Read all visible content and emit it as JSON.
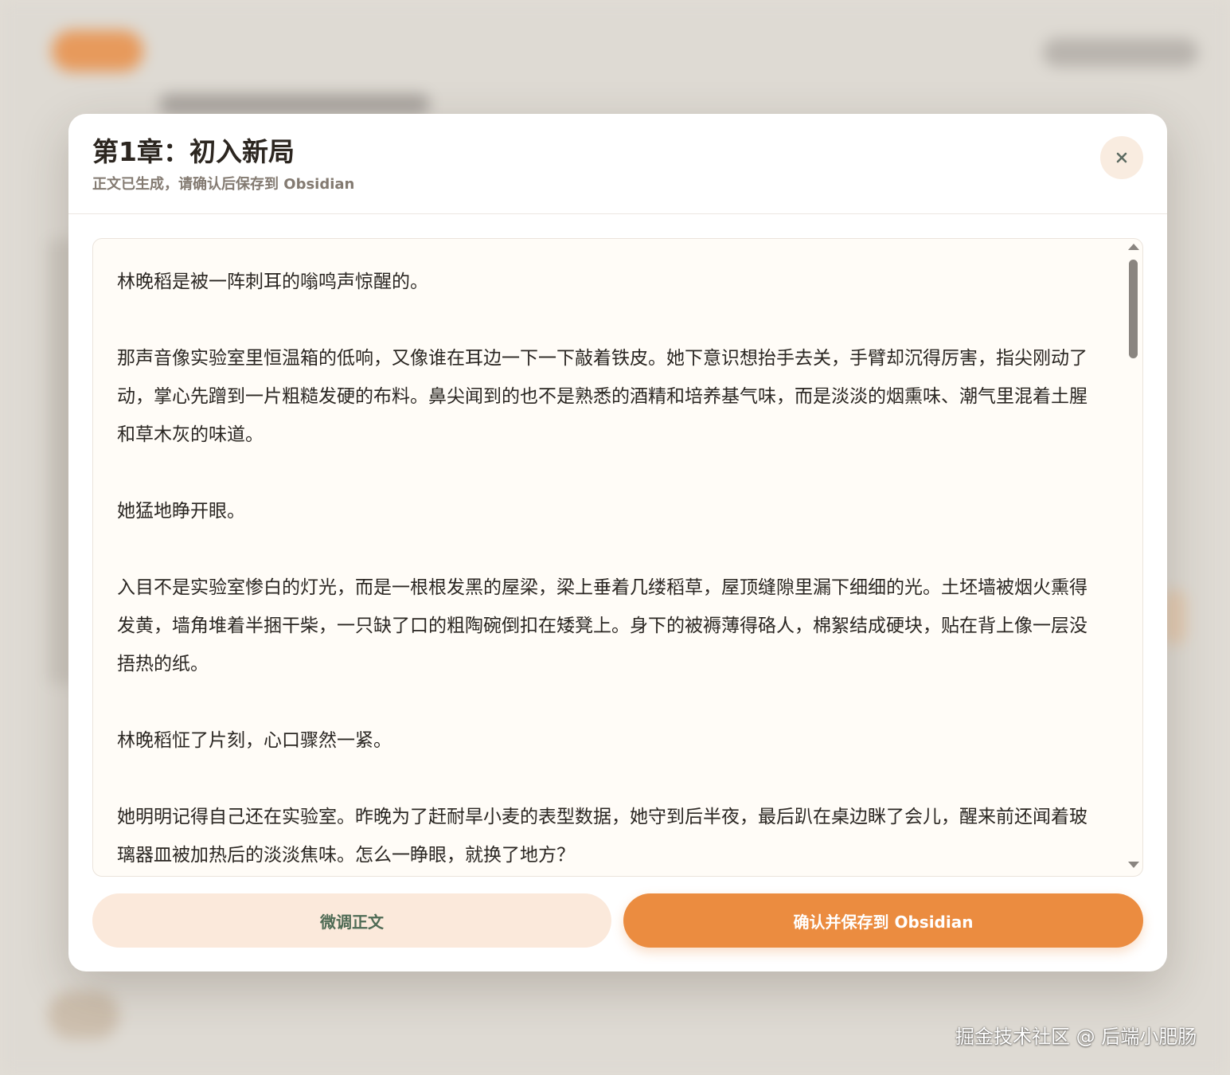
{
  "modal": {
    "title": "第1章：初入新局",
    "subtitle": "正文已生成，请确认后保存到 Obsidian",
    "close_label": "×"
  },
  "content": {
    "paragraphs": [
      "林晚稻是被一阵刺耳的嗡鸣声惊醒的。",
      "那声音像实验室里恒温箱的低响，又像谁在耳边一下一下敲着铁皮。她下意识想抬手去关，手臂却沉得厉害，指尖刚动了动，掌心先蹭到一片粗糙发硬的布料。鼻尖闻到的也不是熟悉的酒精和培养基气味，而是淡淡的烟熏味、潮气里混着土腥和草木灰的味道。",
      "她猛地睁开眼。",
      "入目不是实验室惨白的灯光，而是一根根发黑的屋梁，梁上垂着几缕稻草，屋顶缝隙里漏下细细的光。土坯墙被烟火熏得发黄，墙角堆着半捆干柴，一只缺了口的粗陶碗倒扣在矮凳上。身下的被褥薄得硌人，棉絮结成硬块，贴在背上像一层没捂热的纸。",
      "林晚稻怔了片刻，心口骤然一紧。",
      "她明明记得自己还在实验室。昨晚为了赶耐旱小麦的表型数据，她守到后半夜，最后趴在桌边眯了会儿，醒来前还闻着玻璃器皿被加热后的淡淡焦味。怎么一睁眼，就换了地方？"
    ]
  },
  "buttons": {
    "refine_label": "微调正文",
    "confirm_label": "确认并保存到 Obsidian"
  },
  "watermark": "掘金技术社区 @ 后端小肥肠",
  "colors": {
    "accent": "#eb8c40",
    "secondary_button_bg": "#fbe9db",
    "secondary_button_text": "#4f6b55",
    "close_button_bg": "#f9ece0"
  },
  "icons": {
    "close": "close-icon",
    "scroll_up": "scroll-up-arrow-icon",
    "scroll_down": "scroll-down-arrow-icon"
  }
}
